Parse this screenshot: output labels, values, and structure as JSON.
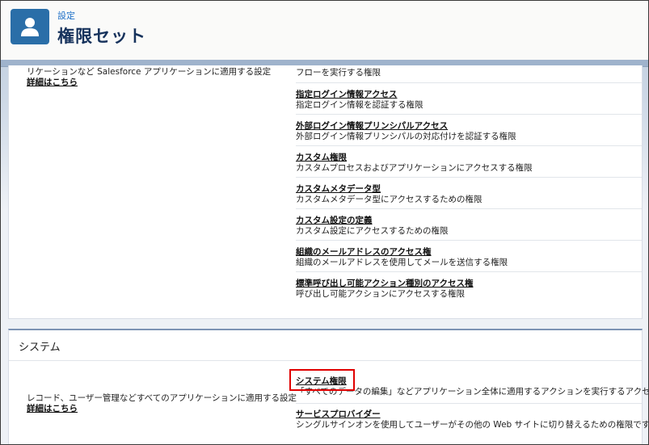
{
  "header": {
    "breadcrumb": "設定",
    "title": "権限セット"
  },
  "top_section": {
    "left_desc": "リケーションなど Salesforce アプリケーションに適用する設定",
    "more_link": "詳細はこちら",
    "partial_desc": "フローを実行する権限",
    "items": [
      {
        "name": "指定ログイン情報アクセス",
        "desc": "指定ログイン情報を認証する権限"
      },
      {
        "name": "外部ログイン情報プリンシパルアクセス",
        "desc": "外部ログイン情報プリンシパルの対応付けを認証する権限"
      },
      {
        "name": "カスタム権限",
        "desc": "カスタムプロセスおよびアプリケーションにアクセスする権限"
      },
      {
        "name": "カスタムメタデータ型",
        "desc": "カスタムメタデータ型にアクセスするための権限"
      },
      {
        "name": "カスタム設定の定義",
        "desc": "カスタム設定にアクセスするための権限"
      },
      {
        "name": "組織のメールアドレスのアクセス権",
        "desc": "組織のメールアドレスを使用してメールを送信する権限"
      },
      {
        "name": "標準呼び出し可能アクション種別のアクセス権",
        "desc": "呼び出し可能アクションにアクセスする権限"
      }
    ]
  },
  "system_section": {
    "title": "システム",
    "left_desc": "レコード、ユーザー管理などすべてのアプリケーションに適用する設定",
    "more_link": "詳細はこちら",
    "items": [
      {
        "name": "システム権限",
        "desc": "「すべてのデータの編集」などアプリケーション全体に適用するアクションを実行するアクセス権限"
      },
      {
        "name": "サービスプロバイダー",
        "desc": "シングルサインオンを使用してユーザーがその他の Web サイトに切り替えるための権限です。"
      }
    ]
  },
  "colors": {
    "highlight": "#e00000",
    "avatar": "#2a6ea8"
  }
}
